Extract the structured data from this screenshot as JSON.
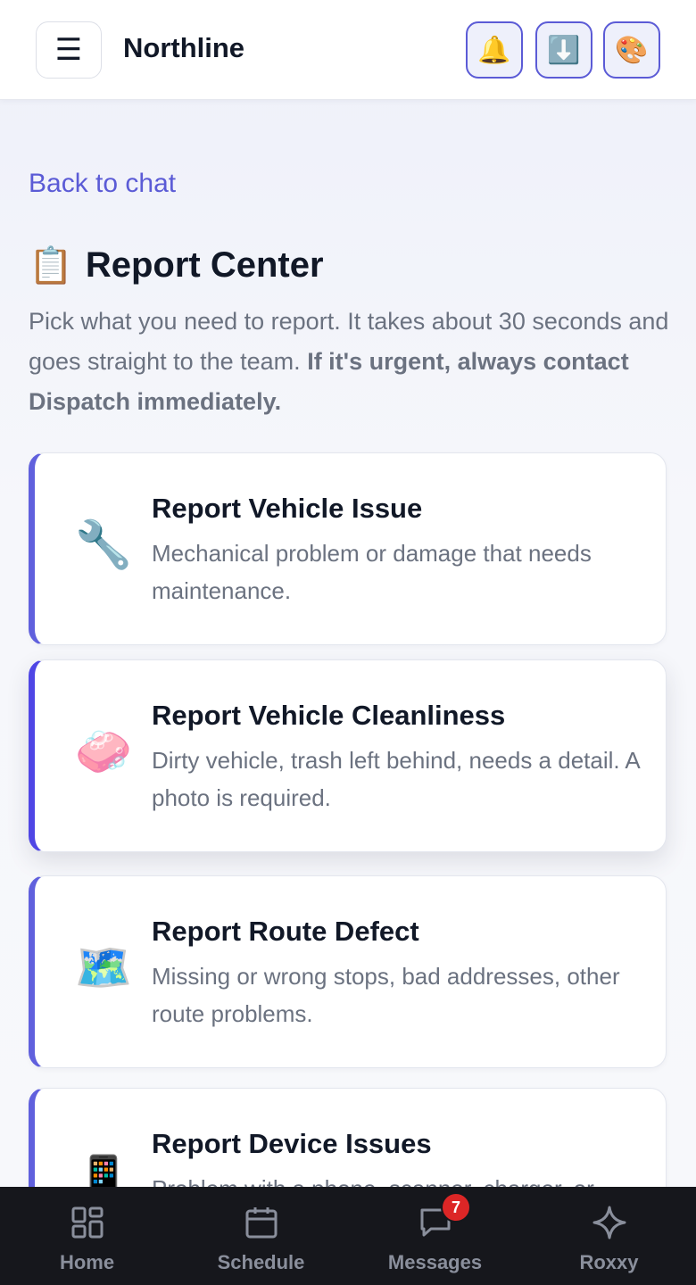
{
  "header": {
    "menu_icon": "☰",
    "brand": "Northline",
    "tools": [
      {
        "name": "bell-icon",
        "glyph": "🔔"
      },
      {
        "name": "download-icon",
        "glyph": "⬇️"
      },
      {
        "name": "palette-icon",
        "glyph": "🎨"
      }
    ]
  },
  "back_link": "Back to chat",
  "title": {
    "icon": "📋",
    "text": "Report Center"
  },
  "intro": {
    "text": "Pick what you need to report. It takes about 30 seconds and goes straight to the team. ",
    "bold": "If it's urgent, always contact Dispatch immediately."
  },
  "cards": [
    {
      "icon": "🔧",
      "title": "Report Vehicle Issue",
      "desc": "Mechanical problem or damage that needs maintenance."
    },
    {
      "icon": "🧼",
      "title": "Report Vehicle Cleanliness",
      "desc": "Dirty vehicle, trash left behind, needs a detail. A photo is required."
    },
    {
      "icon": "🗺️",
      "title": "Report Route Defect",
      "desc": "Missing or wrong stops, bad addresses, other route problems."
    },
    {
      "icon": "📱",
      "title": "Report Device Issues",
      "desc": "Problem with a phone, scanner, charger, or"
    }
  ],
  "nav": {
    "items": [
      {
        "label": "Home",
        "icon": "grid-icon"
      },
      {
        "label": "Schedule",
        "icon": "calendar-icon"
      },
      {
        "label": "Messages",
        "icon": "chat-icon",
        "badge": "7"
      },
      {
        "label": "Roxxy",
        "icon": "sparkle-icon"
      }
    ]
  },
  "colors": {
    "accent": "#5b5bd6",
    "nav_bg": "#16171c",
    "badge": "#dc2626"
  }
}
